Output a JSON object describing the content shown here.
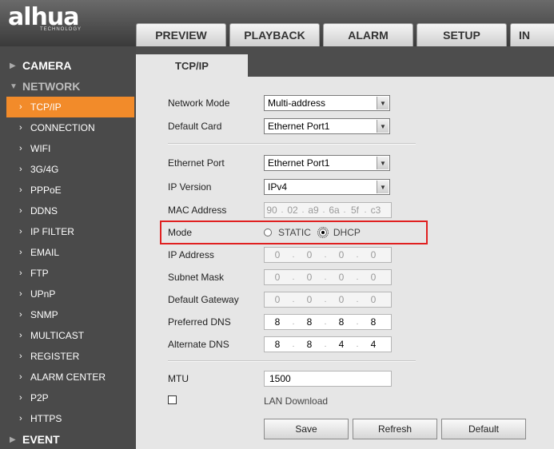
{
  "header": {
    "logo_text": "alhua",
    "logo_sub": "TECHNOLOGY",
    "tabs": [
      "PREVIEW",
      "PLAYBACK",
      "ALARM",
      "SETUP",
      "IN"
    ]
  },
  "sidebar": {
    "sections": [
      {
        "label": "CAMERA"
      },
      {
        "label": "NETWORK"
      },
      {
        "label": "EVENT"
      }
    ],
    "items": [
      "TCP/IP",
      "CONNECTION",
      "WIFI",
      "3G/4G",
      "PPPoE",
      "DDNS",
      "IP FILTER",
      "EMAIL",
      "FTP",
      "UPnP",
      "SNMP",
      "MULTICAST",
      "REGISTER",
      "ALARM CENTER",
      "P2P",
      "HTTPS"
    ],
    "active_item": "TCP/IP"
  },
  "content": {
    "tab_label": "TCP/IP",
    "network_mode": {
      "label": "Network Mode",
      "value": "Multi-address"
    },
    "default_card": {
      "label": "Default Card",
      "value": "Ethernet Port1"
    },
    "ethernet_port": {
      "label": "Ethernet Port",
      "value": "Ethernet Port1"
    },
    "ip_version": {
      "label": "IP Version",
      "value": "IPv4"
    },
    "mac_address": {
      "label": "MAC Address",
      "octets": [
        "90",
        "02",
        "a9",
        "6a",
        "5f",
        "c3"
      ]
    },
    "mode": {
      "label": "Mode",
      "static_label": "STATIC",
      "dhcp_label": "DHCP",
      "selected": "DHCP"
    },
    "ip_address": {
      "label": "IP Address",
      "octets": [
        "0",
        "0",
        "0",
        "0"
      ]
    },
    "subnet_mask": {
      "label": "Subnet Mask",
      "octets": [
        "0",
        "0",
        "0",
        "0"
      ]
    },
    "default_gateway": {
      "label": "Default Gateway",
      "octets": [
        "0",
        "0",
        "0",
        "0"
      ]
    },
    "preferred_dns": {
      "label": "Preferred DNS",
      "octets": [
        "8",
        "8",
        "8",
        "8"
      ]
    },
    "alternate_dns": {
      "label": "Alternate DNS",
      "octets": [
        "8",
        "8",
        "4",
        "4"
      ]
    },
    "mtu": {
      "label": "MTU",
      "value": "1500"
    },
    "lan_download": {
      "label": "LAN Download",
      "checked": false
    },
    "buttons": {
      "save": "Save",
      "refresh": "Refresh",
      "default": "Default"
    }
  },
  "colors": {
    "accent": "#f28b2a",
    "highlight": "#e02020"
  }
}
